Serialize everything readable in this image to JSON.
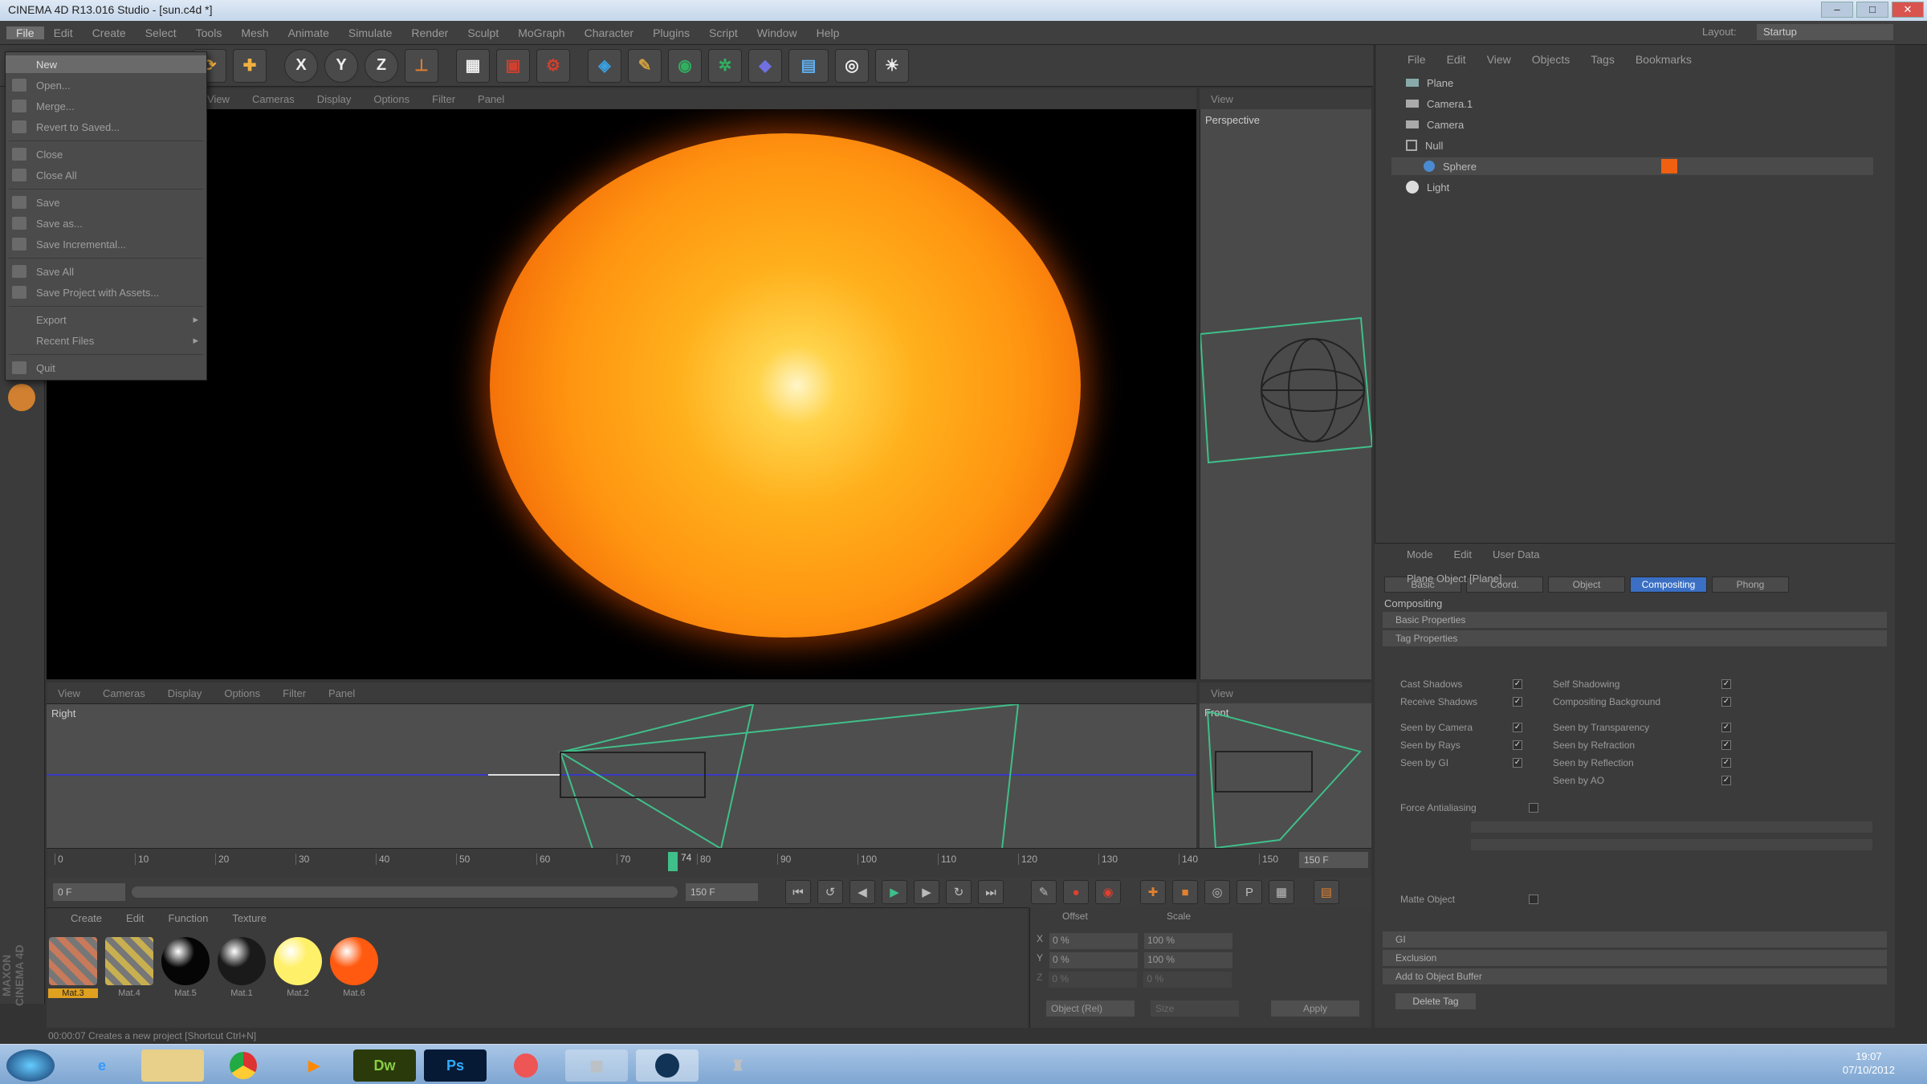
{
  "window": {
    "title": "CINEMA 4D R13.016 Studio - [sun.c4d *]",
    "controls": [
      "–",
      "□",
      "✕"
    ]
  },
  "menubar": [
    "File",
    "Edit",
    "Create",
    "Select",
    "Tools",
    "Mesh",
    "Animate",
    "Simulate",
    "Render",
    "Sculpt",
    "MoGraph",
    "Character",
    "Plugins",
    "Script",
    "Window",
    "Help"
  ],
  "layout": {
    "label": "Layout:",
    "value": "Startup"
  },
  "toolbar": {
    "icons": [
      "undo-icon",
      "rotate-icon",
      "move-icon",
      "x-axis-icon",
      "y-axis-icon",
      "z-axis-icon",
      "coordinate-system-icon",
      "render-view-icon",
      "render-picture-icon",
      "render-settings-icon",
      "cube-icon",
      "spline-icon",
      "nurbs-icon",
      "array-icon",
      "deformer-icon",
      "floor-icon",
      "camera-icon",
      "light-icon"
    ],
    "axis": [
      "X",
      "Y",
      "Z"
    ]
  },
  "filemenu": {
    "items": [
      {
        "label": "New",
        "arrow": false,
        "hl": true
      },
      {
        "label": "Open...",
        "arrow": false
      },
      {
        "label": "Merge...",
        "arrow": false
      },
      {
        "label": "Revert to Saved...",
        "arrow": false
      },
      {
        "label": "Close",
        "arrow": false
      },
      {
        "label": "Close All",
        "arrow": false
      },
      {
        "label": "Save",
        "arrow": false
      },
      {
        "label": "Save as...",
        "arrow": false
      },
      {
        "label": "Save Incremental...",
        "arrow": false
      },
      {
        "label": "Save All",
        "arrow": false
      },
      {
        "label": "Save Project with Assets...",
        "arrow": false
      },
      {
        "label": "Export",
        "arrow": true
      },
      {
        "label": "Recent Files",
        "arrow": true
      },
      {
        "label": "Quit",
        "arrow": false
      }
    ]
  },
  "viewport_top": {
    "menu": [
      "View",
      "Cameras",
      "Display",
      "Options",
      "Filter",
      "Panel"
    ],
    "persp_menu": "View",
    "persp_label": "Perspective"
  },
  "viewport_bottom": {
    "menu": [
      "View",
      "Cameras",
      "Display",
      "Options",
      "Filter",
      "Panel"
    ],
    "right_label": "Right",
    "front_menu": "View",
    "front_label": "Front"
  },
  "timeline": {
    "ticks": [
      "0",
      "10",
      "20",
      "30",
      "40",
      "50",
      "60",
      "70",
      "80",
      "90",
      "100",
      "110",
      "120",
      "130",
      "140",
      "150"
    ],
    "current": "74",
    "end": "150 F"
  },
  "transport": {
    "start": "0 F",
    "range_end": "150 F"
  },
  "materials": {
    "menu": [
      "Create",
      "Edit",
      "Function",
      "Texture"
    ],
    "items": [
      {
        "label": "Mat.3",
        "color": "#c97a5a"
      },
      {
        "label": "Mat.4",
        "color": "#c8b050"
      },
      {
        "label": "Mat.5",
        "color": "#050505"
      },
      {
        "label": "Mat.1",
        "color": "#1a1a1a"
      },
      {
        "label": "Mat.2",
        "color": "#fff06a"
      },
      {
        "label": "Mat.6",
        "color": "#ff5a10"
      }
    ]
  },
  "coords": {
    "head": [
      "Offset",
      "Scale"
    ],
    "rows": [
      [
        "X",
        "0 %",
        "100 %"
      ],
      [
        "Y",
        "0 %",
        "100 %"
      ],
      [
        "Z",
        "0 %",
        "0 %"
      ]
    ],
    "buttons": [
      "Object (Rel)",
      "Size",
      "Apply"
    ]
  },
  "objects": {
    "menu": [
      "File",
      "Edit",
      "View",
      "Objects",
      "Tags",
      "Bookmarks"
    ],
    "items": [
      {
        "label": "Plane",
        "icon": "plane-icon"
      },
      {
        "label": "Camera.1",
        "icon": "camera-icon"
      },
      {
        "label": "Camera",
        "icon": "camera-icon"
      },
      {
        "label": "Null",
        "icon": "null-icon"
      },
      {
        "label": "Sphere",
        "icon": "sphere-icon"
      },
      {
        "label": "Light",
        "icon": "light-icon"
      }
    ]
  },
  "attributes": {
    "menu": [
      "Mode",
      "Edit",
      "User Data"
    ],
    "title": "Plane Object [Plane]",
    "tabs": [
      "Basic",
      "Coord.",
      "Object",
      "Compositing",
      "Phong"
    ],
    "active_tab": "Compositing",
    "section": "Compositing",
    "groups": [
      "Basic Properties",
      "Tag Properties"
    ],
    "left_checks": [
      "Cast Shadows",
      "Receive Shadows",
      "Seen by Camera",
      "Seen by Rays",
      "Seen by GI"
    ],
    "right_checks": [
      "Self Shadowing",
      "Compositing Background",
      "Seen by Transparency",
      "Seen by Refraction",
      "Seen by Reflection",
      "Seen by AO"
    ],
    "antialias": "Force Antialiasing",
    "matte": "Matte Object",
    "bottom_groups": [
      "GI",
      "Exclusion",
      "Add to Object Buffer"
    ],
    "delete_btn": "Delete Tag"
  },
  "status": "00:00:07  Creates a new project [Shortcut Ctrl+N]",
  "taskbar": {
    "apps": [
      "start-icon",
      "ie-icon",
      "explorer-icon",
      "chrome-icon",
      "media-icon",
      "Dw",
      "Ps",
      "app-icon",
      "network-icon",
      "cinema4d-icon",
      "misc-icon"
    ],
    "time": "19:07",
    "date": "07/10/2012"
  },
  "brand": "MAXON CINEMA 4D",
  "colors": {
    "accent": "#3a6fc4",
    "sun_core": "#ffd34a",
    "sun_edge": "#f26a08",
    "wire": "#3fbf8a"
  }
}
